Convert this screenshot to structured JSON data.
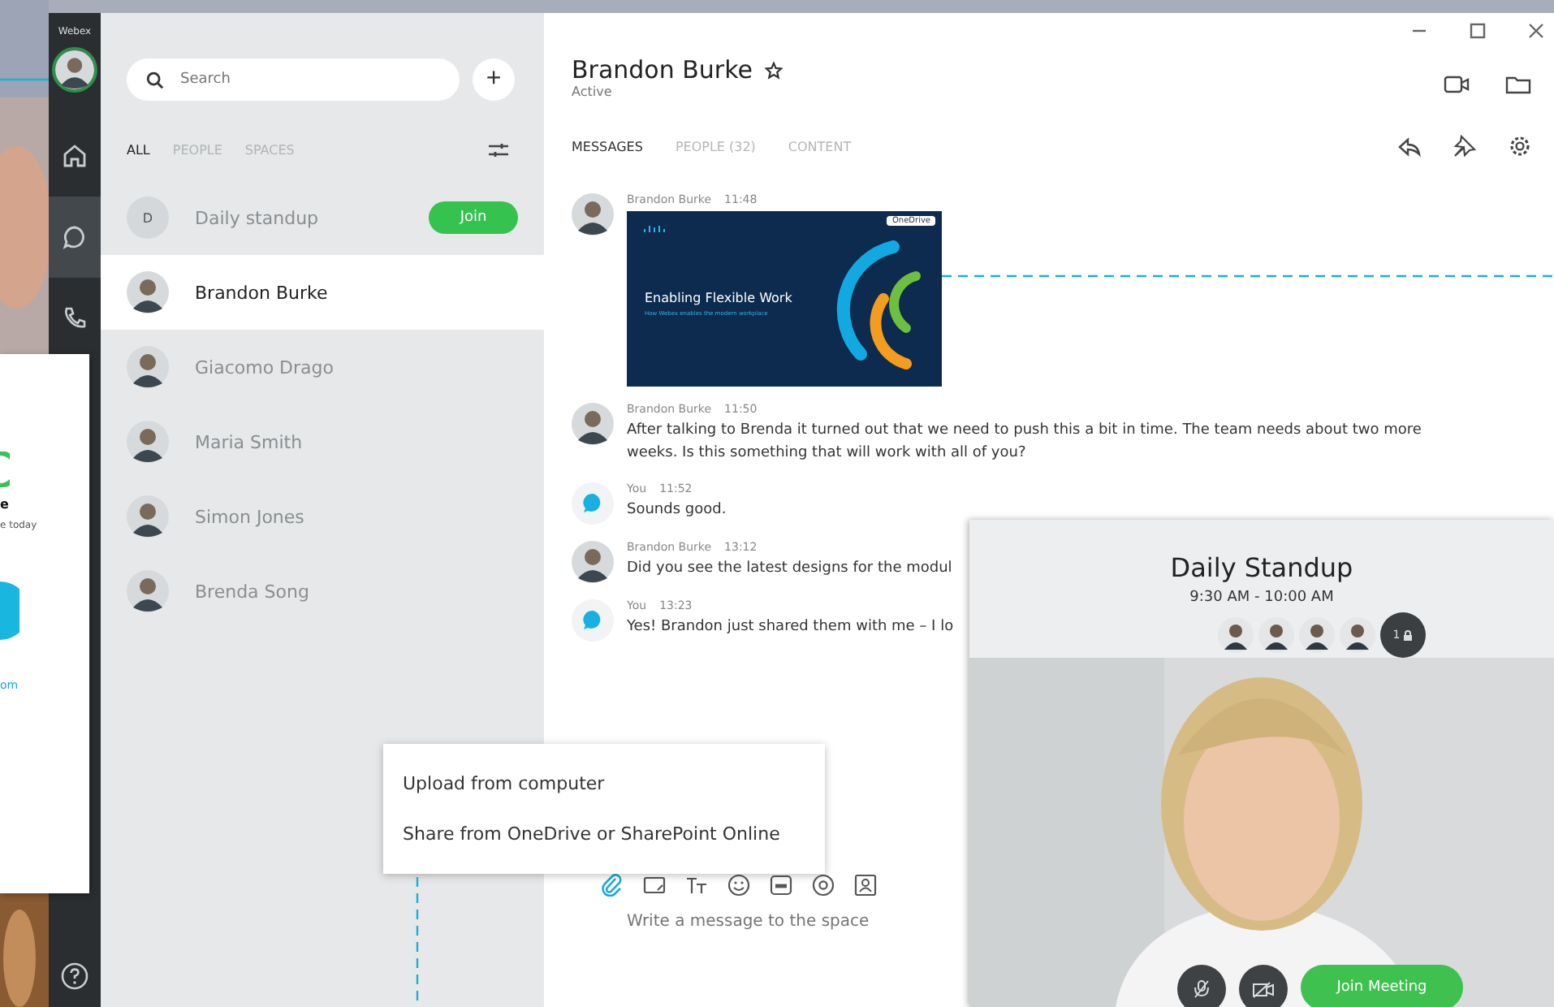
{
  "rail": {
    "brand": "Webex",
    "items": [
      {
        "kind": "home",
        "selected": false
      },
      {
        "kind": "chat",
        "selected": true
      },
      {
        "kind": "phone",
        "selected": false
      }
    ]
  },
  "behind_card": {
    "lines": [
      {
        "kind": "heading",
        "text": "e"
      },
      {
        "kind": "note",
        "text": "e today"
      },
      {
        "kind": "link",
        "text": "om"
      }
    ]
  },
  "list": {
    "search": {
      "placeholder": "Search"
    },
    "add_button": "+",
    "tabs": [
      {
        "label": "ALL",
        "selected": true
      },
      {
        "label": "PEOPLE",
        "selected": false
      },
      {
        "label": "SPACES",
        "selected": false
      }
    ],
    "items": [
      {
        "name": "Daily standup",
        "initial": "D",
        "action": "Join",
        "selected": false
      },
      {
        "name": "Brandon Burke",
        "selected": true
      },
      {
        "name": "Giacomo Drago",
        "selected": false
      },
      {
        "name": "Maria Smith",
        "selected": false
      },
      {
        "name": "Simon Jones",
        "selected": false
      },
      {
        "name": "Brenda Song",
        "selected": false
      }
    ]
  },
  "chat": {
    "title": "Brandon Burke",
    "status": "Active",
    "tabs": [
      {
        "label": "MESSAGES",
        "selected": true
      },
      {
        "label": "PEOPLE (32)",
        "selected": false
      },
      {
        "label": "CONTENT",
        "selected": false
      }
    ],
    "messages": [
      {
        "kind": "attachment",
        "sender": "Brandon Burke",
        "time": "11:48",
        "from_self": false,
        "source": "OneDrive",
        "slide_title": "Enabling Flexible Work",
        "slide_subtitle": "How Webex enables the modern workplace"
      },
      {
        "kind": "text",
        "sender": "Brandon Burke",
        "time": "11:50",
        "from_self": false,
        "text": "After talking to Brenda it turned out that we need to push this a bit in time. The team needs about two more weeks. Is this something that will work with all of you?"
      },
      {
        "kind": "text",
        "sender": "You",
        "time": "11:52",
        "from_self": true,
        "text": "Sounds good."
      },
      {
        "kind": "text",
        "sender": "Brandon Burke",
        "time": "13:12",
        "from_self": false,
        "text": "Did you see the latest designs for the modul"
      },
      {
        "kind": "text",
        "sender": "You",
        "time": "13:23",
        "from_self": true,
        "text": "Yes! Brandon just shared them with me – I lo"
      }
    ],
    "compose": {
      "placeholder": "Write a message to the space"
    },
    "attach_menu": [
      "Upload from computer",
      "Share from OneDrive or SharePoint Online"
    ]
  },
  "meeting": {
    "title": "Daily Standup",
    "time": "9:30 AM - 10:00 AM",
    "participant_count": "1",
    "join_button": "Join Meeting"
  }
}
